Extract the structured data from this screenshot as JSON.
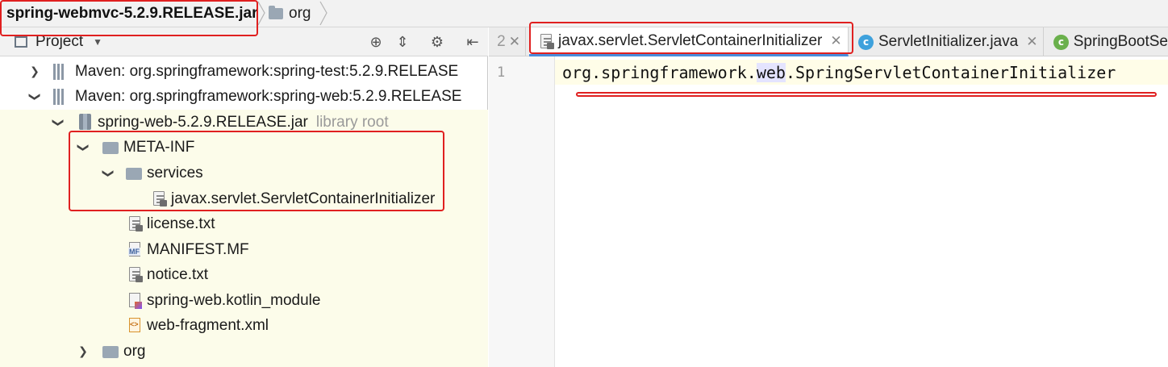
{
  "breadcrumb": {
    "jar": "spring-webmvc-5.2.9.RELEASE.jar",
    "folder": "org"
  },
  "project_panel": {
    "title": "Project",
    "tools": [
      "target-icon",
      "collapse-icon",
      "gear-icon",
      "hide-icon"
    ]
  },
  "tree": {
    "maven_test": "Maven: org.springframework:spring-test:5.2.9.RELEASE",
    "maven_web": "Maven: org.springframework:spring-web:5.2.9.RELEASE",
    "jar": "spring-web-5.2.9.RELEASE.jar",
    "jar_note": "library root",
    "meta_inf": "META-INF",
    "services": "services",
    "initializer": "javax.servlet.ServletContainerInitializer",
    "license": "license.txt",
    "manifest": "MANIFEST.MF",
    "notice": "notice.txt",
    "kotlin_module": "spring-web.kotlin_module",
    "web_fragment": "web-fragment.xml",
    "org": "org"
  },
  "tabs": {
    "partial": "2",
    "active": "javax.servlet.ServletContainerInitializer",
    "tab2": "ServletInitializer.java",
    "tab3": "SpringBootSe"
  },
  "editor": {
    "line_number": "1",
    "code_before": "org.springframework.",
    "code_highlight": "web",
    "code_after": ".SpringServletContainerInitializer"
  },
  "colors": {
    "annotation": "#e02020",
    "tree_highlight": "#fcfcea",
    "class_icon": "#3ea1dc"
  }
}
